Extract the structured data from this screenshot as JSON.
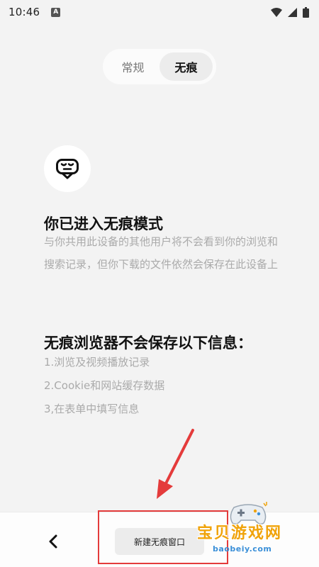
{
  "status_bar": {
    "time": "10:46",
    "notification_icon": "a-letter-icon",
    "icons": [
      "wifi-icon",
      "signal-icon",
      "battery-icon"
    ]
  },
  "mode_switch": {
    "tabs": [
      {
        "label": "常规",
        "active": false
      },
      {
        "label": "无痕",
        "active": true
      }
    ]
  },
  "content": {
    "icon": "incognito-mask-icon",
    "title": "你已进入无痕模式",
    "description": "与你共用此设备的其他用户将不会看到你的浏览和搜索记录，但你下载的文件依然会保存在此设备上",
    "info_title": "无痕浏览器不会保存以下信息：",
    "info_items": [
      "1.浏览及视频播放记录",
      "2.Cookie和网站缓存数据",
      "3,在表单中填写信息"
    ]
  },
  "bottom_bar": {
    "back_icon": "chevron-left-icon",
    "new_incognito_label": "新建无痕窗口"
  },
  "annotation": {
    "color": "#e43b3b"
  },
  "watermark": {
    "title": "宝贝游戏网",
    "url": "baobeiy.com"
  },
  "colors": {
    "background": "#f3f3f3",
    "muted_text": "#aaaaaa",
    "watermark_orange": "#f0a30a",
    "watermark_blue": "#3a8fd8"
  }
}
